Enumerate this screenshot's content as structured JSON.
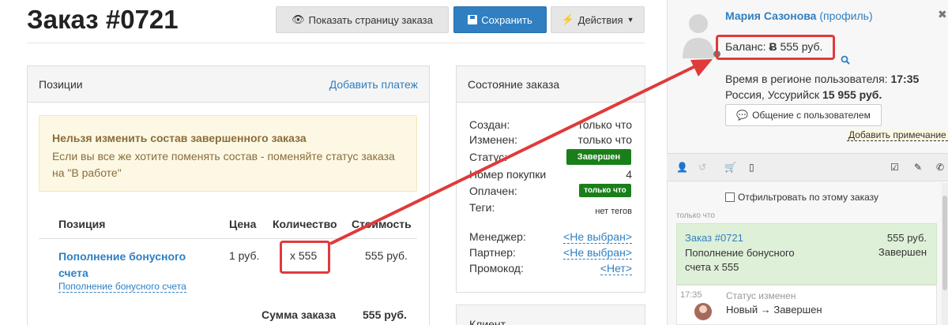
{
  "header": {
    "title": "Заказ #0721",
    "show_page_label": "Показать страницу заказа",
    "save_label": "Сохранить",
    "actions_label": "Действия"
  },
  "positions": {
    "title": "Позиции",
    "add_payment": "Добавить платеж",
    "warning_title": "Нельзя изменить состав завершенного заказа",
    "warning_body": "Если вы все же хотите поменять состав - поменяйте статус заказа на \"В работе\"",
    "columns": [
      "Позиция",
      "Цена",
      "Количество",
      "Стоимость"
    ],
    "rows": [
      {
        "name": "Пополнение бонусного счета",
        "sub": "Пополнение бонусного счета",
        "price": "1 руб.",
        "qty": "x 555",
        "cost": "555 руб."
      }
    ],
    "total_label": "Сумма заказа",
    "total_value": "555 руб."
  },
  "order_state": {
    "title": "Состояние заказа",
    "created_label": "Создан:",
    "created_value": "только что",
    "changed_label": "Изменен:",
    "changed_value": "только что",
    "status_label": "Статус:",
    "status_value": "Завершен",
    "purchase_label": "Номер покупки",
    "purchase_value": "4",
    "paid_label": "Оплачен:",
    "paid_value": "только что",
    "tags_label": "Теги:",
    "tags_value": "нет тегов",
    "manager_label": "Менеджер:",
    "manager_value": "<Не выбран>",
    "partner_label": "Партнер:",
    "partner_value": "<Не выбран>",
    "promo_label": "Промокод:",
    "promo_value": "<Нет>"
  },
  "client": {
    "title": "Клиент"
  },
  "user_panel": {
    "name": "Мария Сазонова",
    "profile_link": "(профиль)",
    "balance_label": "Баланс:",
    "balance_value": "555 руб.",
    "time_label": "Время в регионе пользователя:",
    "time_value": "17:35",
    "location": "Россия, Уссурийск",
    "location_sum": "15 955 руб.",
    "chat_button": "Общение с пользователем",
    "add_note": "Добавить примечание",
    "filter_label": "Отфильтровать по этому заказу",
    "time_ago": "только что",
    "history": {
      "order_link": "Заказ #0721",
      "order_sum": "555 руб.",
      "order_desc": "Пополнение бонусного счета x 555",
      "order_status": "Завершен",
      "event_time": "17:35",
      "event_title": "Статус изменен",
      "event_desc": "Новый → Завершен"
    }
  },
  "colors": {
    "accent": "#2f7fc1",
    "success": "#1a7f1a",
    "highlight": "#e03a3a",
    "warning_bg": "#fcf8e3"
  },
  "icons": [
    "eye-icon",
    "save-icon",
    "bolt-icon",
    "caret-down-icon",
    "close-icon",
    "search-icon",
    "chat-icon",
    "user-icon",
    "history-icon",
    "cart-icon",
    "tablet-icon",
    "checkbox-icon",
    "pencil-icon",
    "phone-icon",
    "avatar"
  ]
}
